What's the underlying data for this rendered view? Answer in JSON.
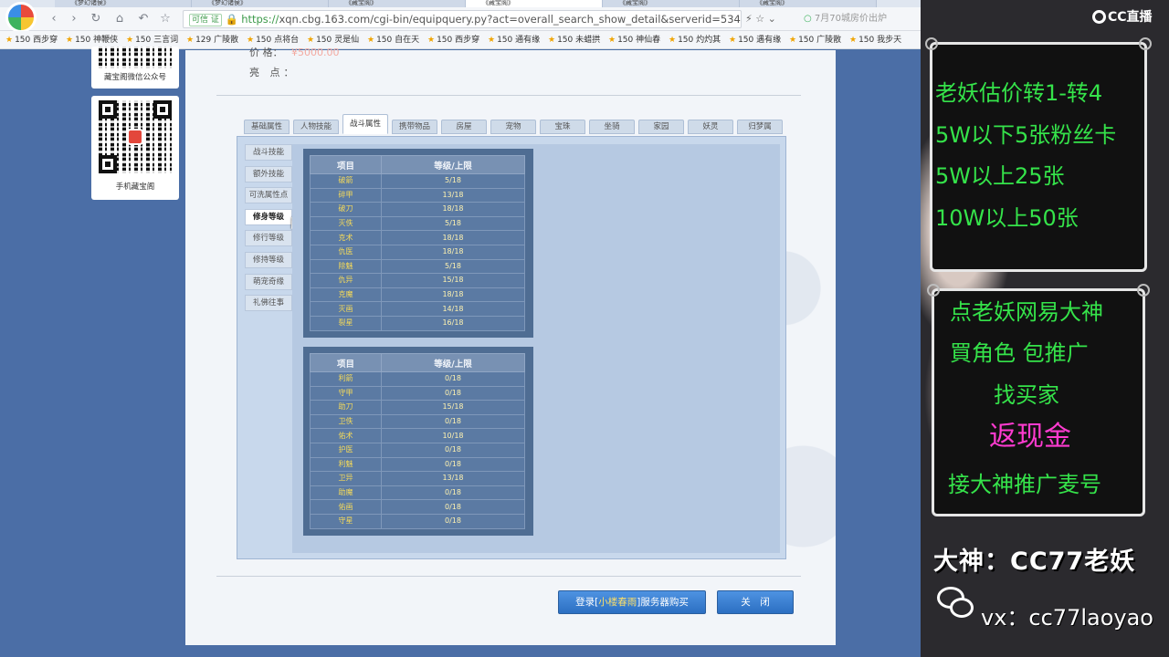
{
  "browser": {
    "tabs": [
      "《梦幻诸侯》",
      "《梦幻诸侯》",
      "《藏宝阁》",
      "《藏宝阁》",
      "《藏宝阁》",
      "《藏宝阁》"
    ],
    "secure_badge": "可信 证",
    "url_https": "https://",
    "url_rest": "xqn.cbg.163.com/cgi-bin/equipquery.py?act=overall_search_show_detail&serverid=534&equip_id=",
    "search_hint": "7月70城房价出炉",
    "bookmarks": [
      "150 西步穿",
      "150 神鞭侠",
      "150 三言词",
      "129 广陵散",
      "150 点将台",
      "150 灵是仙",
      "150 自在天",
      "150 西步穿",
      "150 通有缘",
      "150 未蜡拱",
      "150 神仙春",
      "150 灼灼其",
      "150 遇有缘",
      "150 广陵散",
      "150 我步天"
    ]
  },
  "left_cards": [
    {
      "caption": "藏宝阁微信公众号"
    },
    {
      "caption": "手机藏宝阁"
    }
  ],
  "detail": {
    "price_label": "价 格：",
    "price_value": "¥5000.00",
    "highlight_label": "亮 点：",
    "tabs": [
      "基础属性",
      "人物技能",
      "战斗属性",
      "携带物品",
      "房屋",
      "宠物",
      "宝珠",
      "坐骑",
      "家园",
      "妖灵",
      "归梦属"
    ],
    "active_tab": 2,
    "side_items": [
      "战斗技能",
      "额外技能",
      "可洗属性点",
      "修身等级",
      "修行等级",
      "修持等级",
      "萌宠奇缘",
      "礼佛往事"
    ],
    "active_side": 3,
    "table_header": {
      "item": "项目",
      "level": "等级/上限"
    },
    "table1": [
      [
        "破箭",
        "5/18"
      ],
      [
        "碎甲",
        "13/18"
      ],
      [
        "破刀",
        "18/18"
      ],
      [
        "灭佚",
        "5/18"
      ],
      [
        "克术",
        "18/18"
      ],
      [
        "仇医",
        "18/18"
      ],
      [
        "除魅",
        "5/18"
      ],
      [
        "仇异",
        "15/18"
      ],
      [
        "克魔",
        "18/18"
      ],
      [
        "灭画",
        "14/18"
      ],
      [
        "裂星",
        "16/18"
      ]
    ],
    "table2": [
      [
        "利箭",
        "0/18"
      ],
      [
        "守甲",
        "0/18"
      ],
      [
        "助刀",
        "15/18"
      ],
      [
        "卫佚",
        "0/18"
      ],
      [
        "佑术",
        "10/18"
      ],
      [
        "护医",
        "0/18"
      ],
      [
        "利魅",
        "0/18"
      ],
      [
        "卫异",
        "13/18"
      ],
      [
        "助魔",
        "0/18"
      ],
      [
        "佑画",
        "0/18"
      ],
      [
        "守星",
        "0/18"
      ]
    ],
    "buy_button": {
      "prefix": "登录[",
      "server": "小楼春雨",
      "suffix": "]服务器购买"
    },
    "close_button": "关　闭"
  },
  "overlay": {
    "logo": "CC直播",
    "promo1": [
      "老妖估价转1-转4",
      "5W以下5张粉丝卡",
      "5W以上25张",
      "10W以上50张"
    ],
    "promo2": [
      "点老妖网易大神",
      "買角色 包推广",
      "找买家"
    ],
    "promo2_pink": "返现金",
    "promo2_last": "接大神推广麦号",
    "streamer": "大神：CC77老妖",
    "wechat": "vx：cc77laoyao",
    "colors": {
      "green": "#35e34a",
      "pink": "#ff3bd0"
    }
  }
}
